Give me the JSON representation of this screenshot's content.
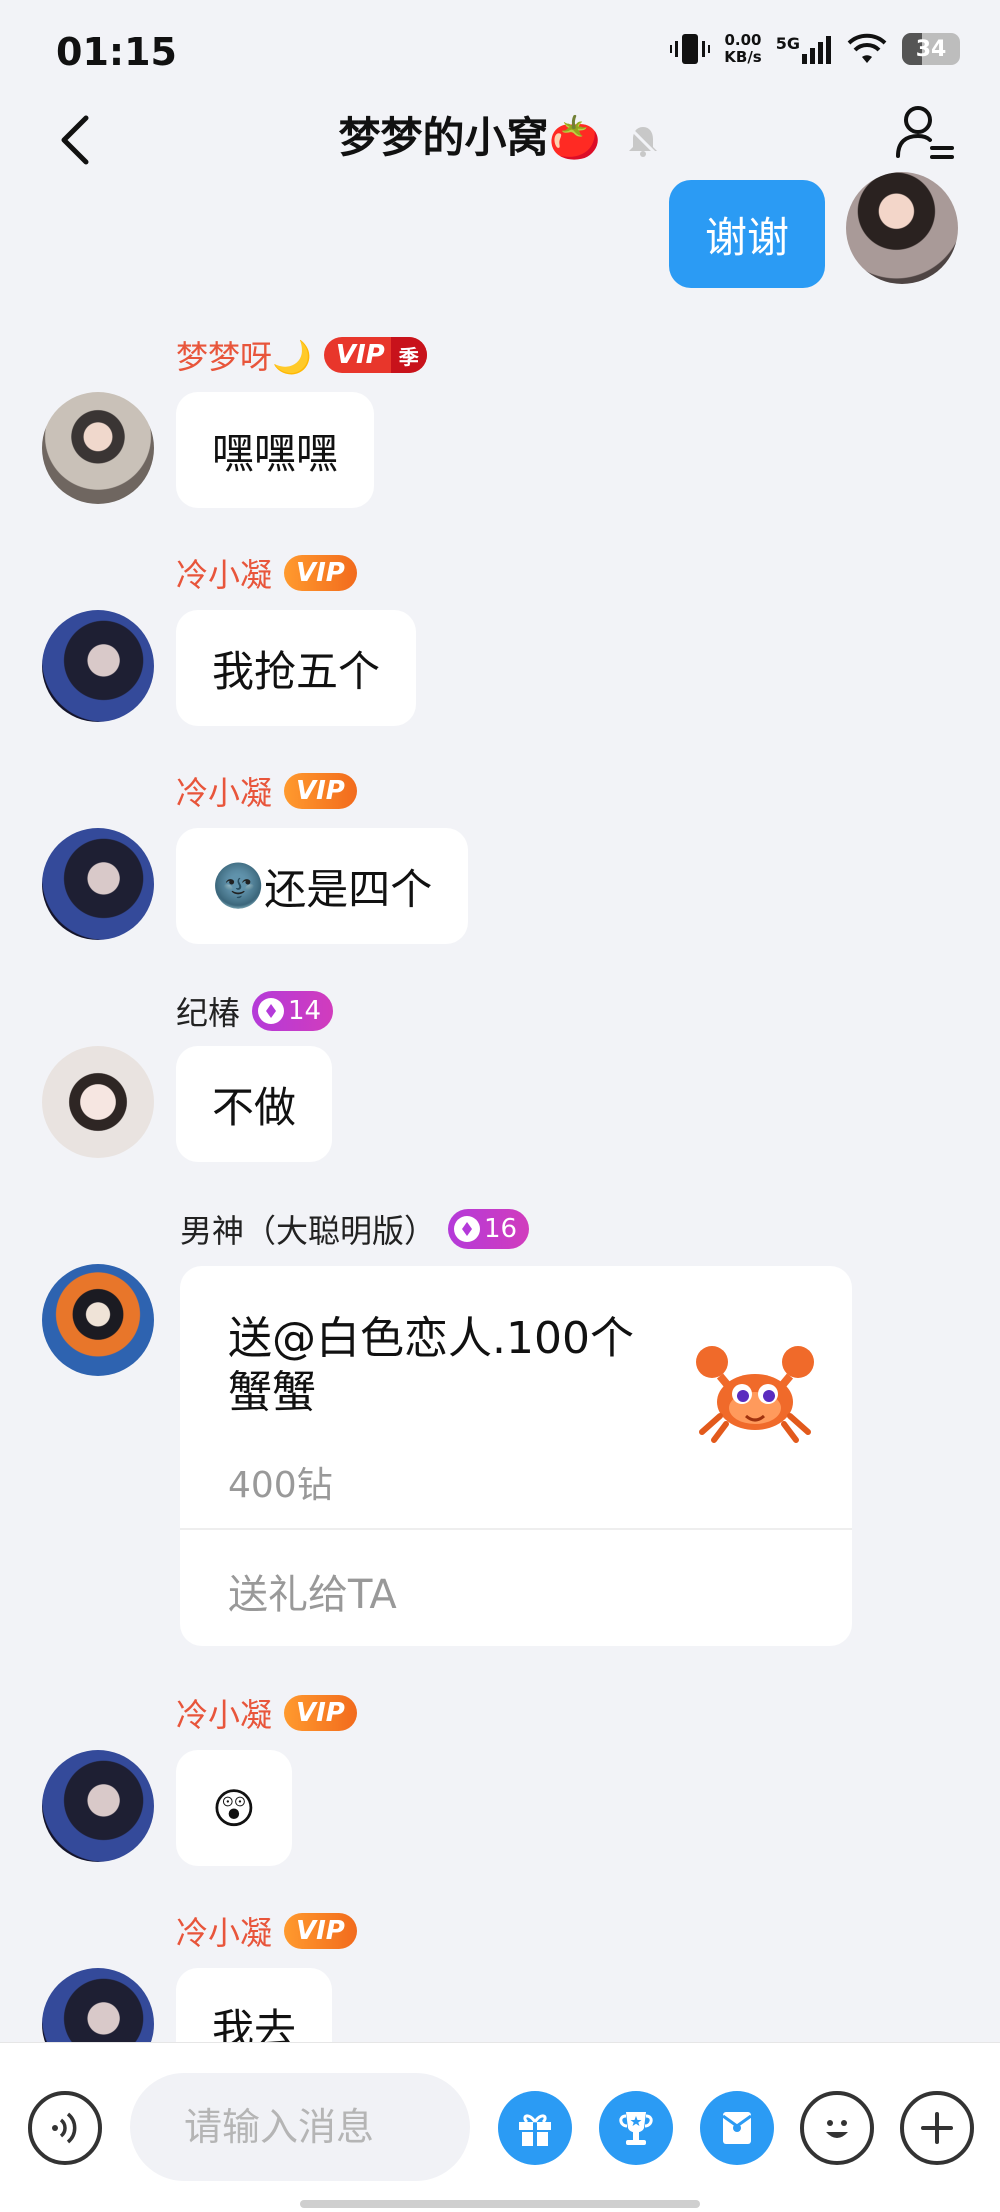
{
  "status": {
    "time": "01:15",
    "net_speed_top": "0.00",
    "net_speed_unit": "KB/s",
    "network": "5G",
    "battery": "34",
    "battery_level": 0.34
  },
  "header": {
    "title": "梦梦的小窝",
    "title_emoji": "🍅"
  },
  "messages": [
    {
      "type": "mine",
      "text": "谢谢"
    },
    {
      "name": "梦梦呀",
      "name_emoji": "🌙",
      "badge": "VIP",
      "badge_extra": "季",
      "text": "嘿嘿嘿"
    },
    {
      "name": "冷小凝",
      "badge": "VIP",
      "text": "我抢五个"
    },
    {
      "name": "冷小凝",
      "badge": "VIP",
      "text_emoji": "🌚",
      "text": "还是四个"
    },
    {
      "name": "纪椿",
      "level": "14",
      "text": "不做"
    },
    {
      "name": "男神（大聪明版）",
      "level": "16"
    },
    {
      "name": "冷小凝",
      "badge": "VIP",
      "text": "😲"
    },
    {
      "name": "冷小凝",
      "badge": "VIP",
      "text": "我去"
    }
  ],
  "gift": {
    "text": "送@白色恋人.100个蟹蟹",
    "price": "400钻",
    "action": "送礼给TA",
    "gift_icon": "crab"
  },
  "input": {
    "placeholder": "请输入消息"
  },
  "toolbar_icons": [
    "voice-icon",
    "gift-icon",
    "trophy-icon",
    "red-envelope-icon",
    "emoji-icon",
    "plus-icon"
  ]
}
